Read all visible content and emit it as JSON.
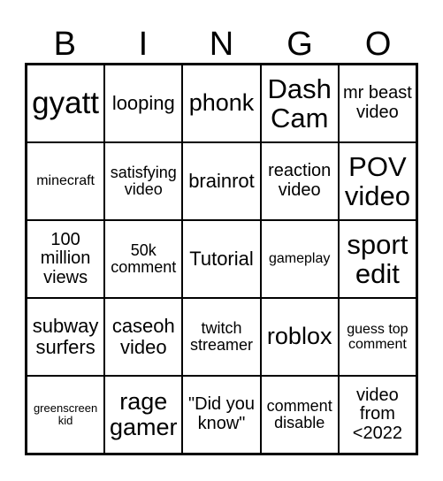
{
  "header": [
    "B",
    "I",
    "N",
    "G",
    "O"
  ],
  "cells": [
    "gyatt",
    "looping",
    "phonk",
    "Dash Cam",
    "mr beast video",
    "minecraft",
    "satisfying video",
    "brainrot",
    "reaction video",
    "POV video",
    "100 million views",
    "50k comment",
    "Tutorial",
    "gameplay",
    "sport edit",
    "subway surfers",
    "caseoh video",
    "twitch streamer",
    "roblox",
    "guess top comment",
    "greenscreen kid",
    "rage gamer",
    "\"Did you know\"",
    "comment disable",
    "video from <2022"
  ]
}
